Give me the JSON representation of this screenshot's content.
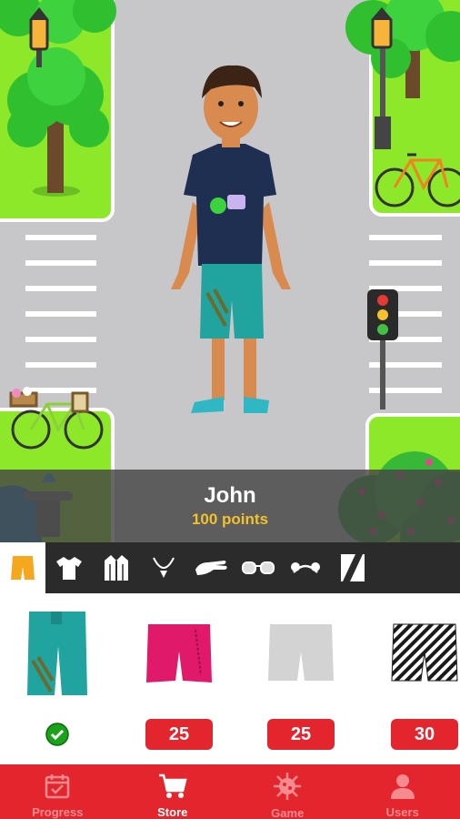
{
  "profile": {
    "name": "John",
    "points": "100 points"
  },
  "categories": [
    {
      "id": "shorts",
      "icon": "shorts-icon",
      "active": true
    },
    {
      "id": "shirts",
      "icon": "tshirt-icon"
    },
    {
      "id": "jackets",
      "icon": "jacket-icon"
    },
    {
      "id": "necklaces",
      "icon": "necklace-icon"
    },
    {
      "id": "gloves",
      "icon": "glove-icon"
    },
    {
      "id": "glasses",
      "icon": "glasses-icon"
    },
    {
      "id": "headbands",
      "icon": "headband-icon"
    },
    {
      "id": "backgrounds",
      "icon": "background-icon"
    }
  ],
  "items": [
    {
      "name": "teal-shorts",
      "color": "#21a3a0",
      "owned": true
    },
    {
      "name": "pink-shorts",
      "color": "#e0196a",
      "price": "25"
    },
    {
      "name": "grey-shorts",
      "color": "#d3d3d3",
      "price": "25"
    },
    {
      "name": "striped-shorts",
      "color": "#1b1b1b",
      "price": "30"
    }
  ],
  "tabs": [
    {
      "label": "Progress",
      "icon": "calendar-check-icon"
    },
    {
      "label": "Store",
      "icon": "cart-icon",
      "active": true
    },
    {
      "label": "Game",
      "icon": "virus-icon"
    },
    {
      "label": "Users",
      "icon": "user-icon"
    }
  ],
  "colors": {
    "accent": "#e3262e",
    "points": "#f2c12e",
    "grass": "#8ee82a",
    "road": "#c7c7c9"
  }
}
